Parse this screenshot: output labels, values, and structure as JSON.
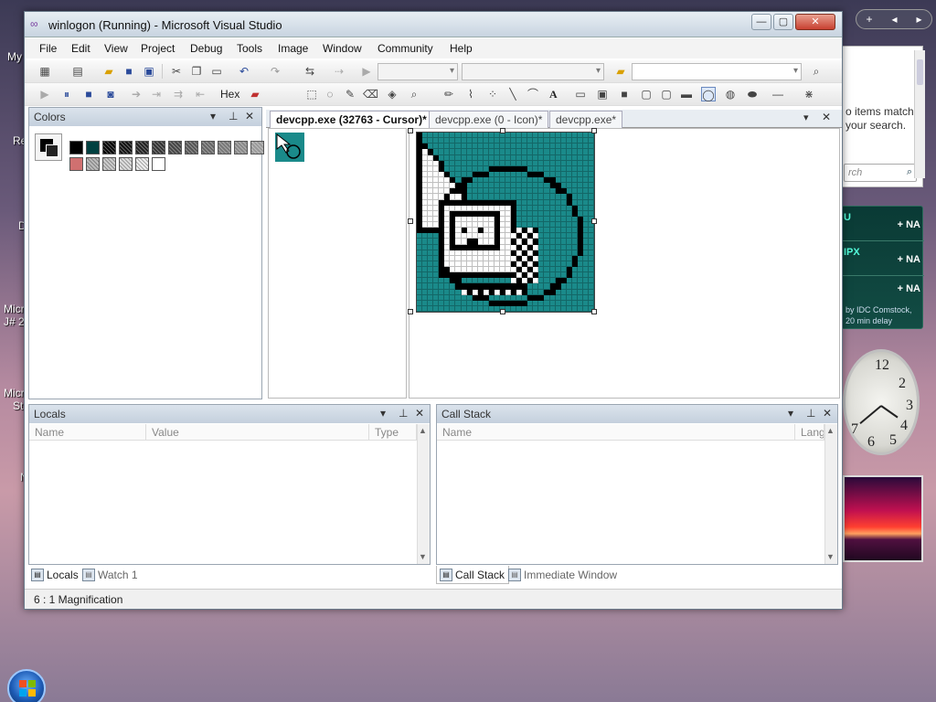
{
  "desktop": {
    "labels": [
      "My",
      "Re",
      "D",
      "Micr",
      "J# 2",
      "Micr",
      "St",
      "N"
    ]
  },
  "sidebar": {
    "gadget_controls": [
      "+",
      "◂",
      "▸"
    ],
    "search": {
      "message": "o items match\nyour search.",
      "placeholder": "rch"
    },
    "stocks": {
      "rows": [
        {
          "symbol": "U",
          "value": "+ NA"
        },
        {
          "symbol": "IPX",
          "value": "+ NA"
        },
        {
          "symbol": "",
          "value": "+ NA"
        }
      ],
      "footer": "by IDC Comstock, 20 min delay"
    },
    "clock_numbers": [
      "12",
      "2",
      "3",
      "4",
      "5",
      "6",
      "7"
    ]
  },
  "window": {
    "title": "winlogon (Running) - Microsoft Visual Studio",
    "controls": {
      "minimize": "—",
      "maximize": "▢",
      "close": "✕"
    }
  },
  "menu": [
    "File",
    "Edit",
    "View",
    "Project",
    "Debug",
    "Tools",
    "Image",
    "Window",
    "Community",
    "Help"
  ],
  "toolbar2": {
    "hex_label": "Hex",
    "text_tool": "A"
  },
  "colors_panel": {
    "title": "Colors",
    "swatches_row1": [
      "#000000",
      "#004040",
      "#000000",
      "#111111",
      "#222222",
      "#333333",
      "#444444",
      "#555555",
      "#666666",
      "#777777",
      "#888888",
      "#999999"
    ],
    "swatches_row2": [
      "#d07070",
      "#bbbbbb",
      "#cccccc",
      "#dddddd",
      "#eeeeee",
      "#ffffff"
    ]
  },
  "editor": {
    "tabs": [
      "devcpp.exe (32763 - Cursor)*",
      "devcpp.exe (0 - Icon)*",
      "devcpp.exe*"
    ],
    "icon_bg": "#1a8a8a"
  },
  "locals_panel": {
    "title": "Locals",
    "columns": [
      "Name",
      "Value",
      "Type"
    ],
    "tabs": [
      "Locals",
      "Watch 1"
    ]
  },
  "callstack_panel": {
    "title": "Call Stack",
    "columns": [
      "Name",
      "Lang"
    ],
    "tabs": [
      "Call Stack",
      "Immediate Window"
    ]
  },
  "status": {
    "text": "6 : 1 Magnification"
  },
  "colors": {
    "accent": "#1a8a8a",
    "title_bg": "#dde5ee",
    "close_red": "#c84030"
  }
}
